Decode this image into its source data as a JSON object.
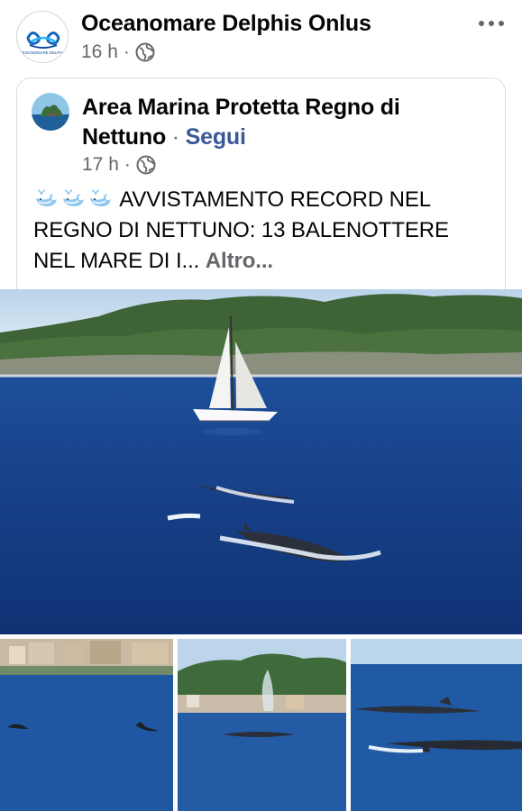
{
  "post": {
    "author": "Oceanomare Delphis Onlus",
    "avatar_caption": "OCEANOMARE DELPHIS",
    "time": "16 h",
    "dot": "·",
    "audience_icon": "globe-icon",
    "more_icon": "more-dots-icon"
  },
  "shared": {
    "page_name": "Area Marina Protetta Regno di Nettuno",
    "separator": "·",
    "follow_label": "Segui",
    "time": "17 h",
    "dot": "·",
    "audience_icon": "globe-icon",
    "emoji_icon": "whale-emoji-icon",
    "text": "AVVISTAMENTO RECORD NEL REGNO DI NETTUNO: 13 BALENOTTERE NEL MARE DI I...",
    "more_label": "Altro..."
  },
  "photos": [
    {
      "subject": "sailboat and whales near island"
    },
    {
      "subject": "whales near coastline"
    },
    {
      "subject": "whale blow near island"
    },
    {
      "subject": "two whales surfacing"
    }
  ],
  "colors": {
    "text": "#050505",
    "secondary": "#65676b",
    "link": "#385898",
    "sea": "#1d4f9a"
  }
}
